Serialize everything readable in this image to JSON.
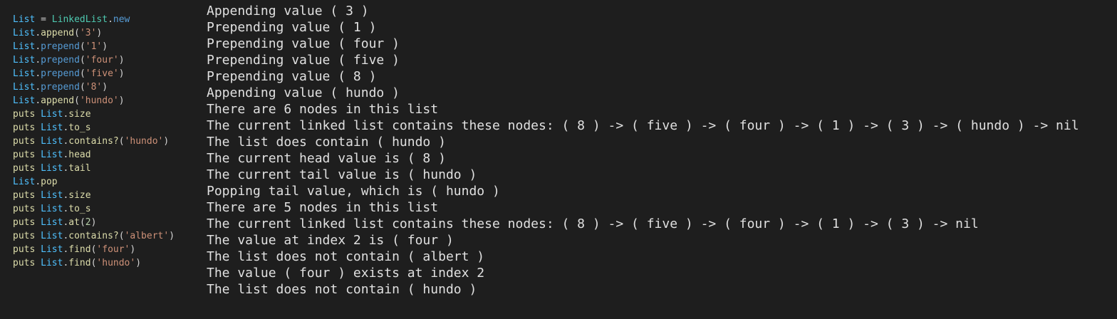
{
  "code": {
    "lines": [
      [
        {
          "t": "List",
          "c": "var"
        },
        {
          "t": " = ",
          "c": "plain"
        },
        {
          "t": "LinkedList",
          "c": "class"
        },
        {
          "t": ".",
          "c": "plain"
        },
        {
          "t": "new",
          "c": "method"
        }
      ],
      [
        {
          "t": "List",
          "c": "var"
        },
        {
          "t": ".",
          "c": "plain"
        },
        {
          "t": "append",
          "c": "fn"
        },
        {
          "t": "(",
          "c": "plain"
        },
        {
          "t": "'3'",
          "c": "str"
        },
        {
          "t": ")",
          "c": "plain"
        }
      ],
      [
        {
          "t": "List",
          "c": "var"
        },
        {
          "t": ".",
          "c": "plain"
        },
        {
          "t": "prepend",
          "c": "method"
        },
        {
          "t": "(",
          "c": "plain"
        },
        {
          "t": "'1'",
          "c": "str"
        },
        {
          "t": ")",
          "c": "plain"
        }
      ],
      [
        {
          "t": "List",
          "c": "var"
        },
        {
          "t": ".",
          "c": "plain"
        },
        {
          "t": "prepend",
          "c": "method"
        },
        {
          "t": "(",
          "c": "plain"
        },
        {
          "t": "'four'",
          "c": "str"
        },
        {
          "t": ")",
          "c": "plain"
        }
      ],
      [
        {
          "t": "List",
          "c": "var"
        },
        {
          "t": ".",
          "c": "plain"
        },
        {
          "t": "prepend",
          "c": "method"
        },
        {
          "t": "(",
          "c": "plain"
        },
        {
          "t": "'five'",
          "c": "str"
        },
        {
          "t": ")",
          "c": "plain"
        }
      ],
      [
        {
          "t": "List",
          "c": "var"
        },
        {
          "t": ".",
          "c": "plain"
        },
        {
          "t": "prepend",
          "c": "method"
        },
        {
          "t": "(",
          "c": "plain"
        },
        {
          "t": "'8'",
          "c": "str"
        },
        {
          "t": ")",
          "c": "plain"
        }
      ],
      [
        {
          "t": "List",
          "c": "var"
        },
        {
          "t": ".",
          "c": "plain"
        },
        {
          "t": "append",
          "c": "fn"
        },
        {
          "t": "(",
          "c": "plain"
        },
        {
          "t": "'hundo'",
          "c": "str"
        },
        {
          "t": ")",
          "c": "plain"
        }
      ],
      [
        {
          "t": "puts ",
          "c": "fn"
        },
        {
          "t": "List",
          "c": "var"
        },
        {
          "t": ".",
          "c": "plain"
        },
        {
          "t": "size",
          "c": "fn"
        }
      ],
      [
        {
          "t": "puts ",
          "c": "fn"
        },
        {
          "t": "List",
          "c": "var"
        },
        {
          "t": ".",
          "c": "plain"
        },
        {
          "t": "to_s",
          "c": "fn"
        }
      ],
      [
        {
          "t": "puts ",
          "c": "fn"
        },
        {
          "t": "List",
          "c": "var"
        },
        {
          "t": ".",
          "c": "plain"
        },
        {
          "t": "contains?",
          "c": "fn"
        },
        {
          "t": "(",
          "c": "plain"
        },
        {
          "t": "'hundo'",
          "c": "str"
        },
        {
          "t": ")",
          "c": "plain"
        }
      ],
      [
        {
          "t": "puts ",
          "c": "fn"
        },
        {
          "t": "List",
          "c": "var"
        },
        {
          "t": ".",
          "c": "plain"
        },
        {
          "t": "head",
          "c": "fn"
        }
      ],
      [
        {
          "t": "puts ",
          "c": "fn"
        },
        {
          "t": "List",
          "c": "var"
        },
        {
          "t": ".",
          "c": "plain"
        },
        {
          "t": "tail",
          "c": "fn"
        }
      ],
      [
        {
          "t": "List",
          "c": "var"
        },
        {
          "t": ".",
          "c": "plain"
        },
        {
          "t": "pop",
          "c": "fn"
        }
      ],
      [
        {
          "t": "puts ",
          "c": "fn"
        },
        {
          "t": "List",
          "c": "var"
        },
        {
          "t": ".",
          "c": "plain"
        },
        {
          "t": "size",
          "c": "fn"
        }
      ],
      [
        {
          "t": "puts ",
          "c": "fn"
        },
        {
          "t": "List",
          "c": "var"
        },
        {
          "t": ".",
          "c": "plain"
        },
        {
          "t": "to_s",
          "c": "fn"
        }
      ],
      [
        {
          "t": "puts ",
          "c": "fn"
        },
        {
          "t": "List",
          "c": "var"
        },
        {
          "t": ".",
          "c": "plain"
        },
        {
          "t": "at",
          "c": "fn"
        },
        {
          "t": "(",
          "c": "plain"
        },
        {
          "t": "2",
          "c": "num"
        },
        {
          "t": ")",
          "c": "plain"
        }
      ],
      [
        {
          "t": "puts ",
          "c": "fn"
        },
        {
          "t": "List",
          "c": "var"
        },
        {
          "t": ".",
          "c": "plain"
        },
        {
          "t": "contains?",
          "c": "fn"
        },
        {
          "t": "(",
          "c": "plain"
        },
        {
          "t": "'albert'",
          "c": "str"
        },
        {
          "t": ")",
          "c": "plain"
        }
      ],
      [
        {
          "t": "puts ",
          "c": "fn"
        },
        {
          "t": "List",
          "c": "var"
        },
        {
          "t": ".",
          "c": "plain"
        },
        {
          "t": "find",
          "c": "fn"
        },
        {
          "t": "(",
          "c": "plain"
        },
        {
          "t": "'four'",
          "c": "str"
        },
        {
          "t": ")",
          "c": "plain"
        }
      ],
      [
        {
          "t": "puts ",
          "c": "fn"
        },
        {
          "t": "List",
          "c": "var"
        },
        {
          "t": ".",
          "c": "plain"
        },
        {
          "t": "find",
          "c": "fn"
        },
        {
          "t": "(",
          "c": "plain"
        },
        {
          "t": "'hundo'",
          "c": "str"
        },
        {
          "t": ")",
          "c": "plain"
        }
      ]
    ]
  },
  "output": {
    "lines": [
      "Appending value ( 3 )",
      "Prepending value ( 1 )",
      "Prepending value ( four )",
      "Prepending value ( five )",
      "Prepending value ( 8 )",
      "Appending value ( hundo )",
      "There are 6 nodes in this list",
      "The current linked list contains these nodes: ( 8 ) -> ( five ) -> ( four ) -> ( 1 ) -> ( 3 ) -> ( hundo ) -> nil",
      "The list does contain ( hundo )",
      "The current head value is ( 8 )",
      "The current tail value is ( hundo )",
      "Popping tail value, which is ( hundo )",
      "There are 5 nodes in this list",
      "The current linked list contains these nodes: ( 8 ) -> ( five ) -> ( four ) -> ( 1 ) -> ( 3 ) -> nil",
      "The value at index 2 is ( four )",
      "The list does not contain ( albert )",
      "The value ( four ) exists at index 2",
      "The list does not contain ( hundo )"
    ]
  },
  "colors": {
    "background": "#1e1e1e",
    "output_text": "#e0e0e0",
    "code_variable": "#4fc1ff",
    "code_class": "#4ec9b0",
    "code_method": "#569cd6",
    "code_function": "#dcdcaa",
    "code_string": "#ce9178"
  }
}
